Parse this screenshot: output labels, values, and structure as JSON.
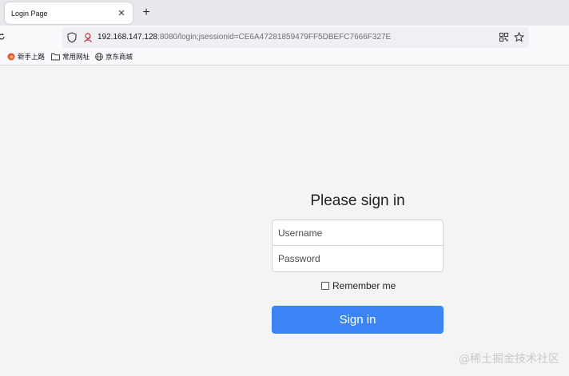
{
  "browser": {
    "tab": {
      "title": "Login Page",
      "close_glyph": "✕"
    },
    "new_tab_glyph": "+",
    "url": {
      "host": "192.168.147.128",
      "rest": ":8080/login;jsessionid=CE6A47281859479FF5DBEFC7666F327E"
    },
    "bookmarks": [
      {
        "label": "新手上路",
        "icon": "firefox-icon"
      },
      {
        "label": "常用网址",
        "icon": "folder-icon"
      },
      {
        "label": "京东商城",
        "icon": "globe-icon"
      }
    ]
  },
  "login": {
    "heading": "Please sign in",
    "username_placeholder": "Username",
    "password_placeholder": "Password",
    "remember_label": "Remember me",
    "signin_label": "Sign in",
    "button_color": "#3a84f5"
  },
  "watermark": "@稀土掘金技术社区"
}
